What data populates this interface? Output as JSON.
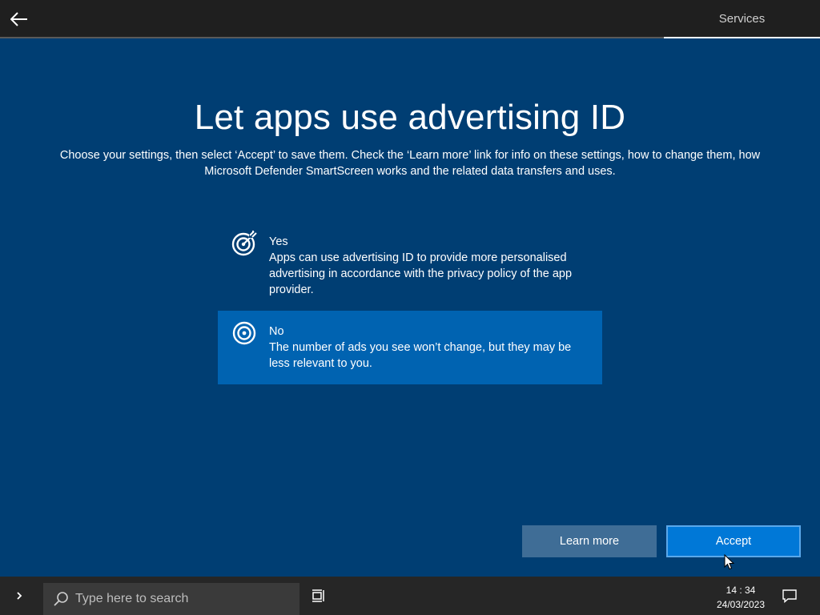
{
  "header": {
    "back_icon": "arrow-left-icon",
    "tab_label": "Services"
  },
  "main": {
    "title": "Let apps use advertising ID",
    "subtitle": "Choose your settings, then select ‘Accept’ to save them. Check the ‘Learn more’ link for info on these settings, how to change them, how Microsoft Defender SmartScreen works and the related data transfers and uses.",
    "options": [
      {
        "icon": "target-arrow-icon",
        "title": "Yes",
        "description": "Apps can use advertising ID to provide more personalised advertising in accordance with the privacy policy of the app provider.",
        "selected": false
      },
      {
        "icon": "target-icon",
        "title": "No",
        "description": "The number of ads you see won’t change, but they may be less relevant to you.",
        "selected": true
      }
    ]
  },
  "buttons": {
    "learn_more": "Learn more",
    "accept": "Accept"
  },
  "taskbar": {
    "search_placeholder": "Type here to search",
    "time": "14 : 34",
    "date": "24/03/2023"
  },
  "colors": {
    "background": "#003e73",
    "selected_option": "#0063b1",
    "accept_button": "#0078d7",
    "learn_more_button": "#3f6d96",
    "taskbar": "#262626"
  }
}
